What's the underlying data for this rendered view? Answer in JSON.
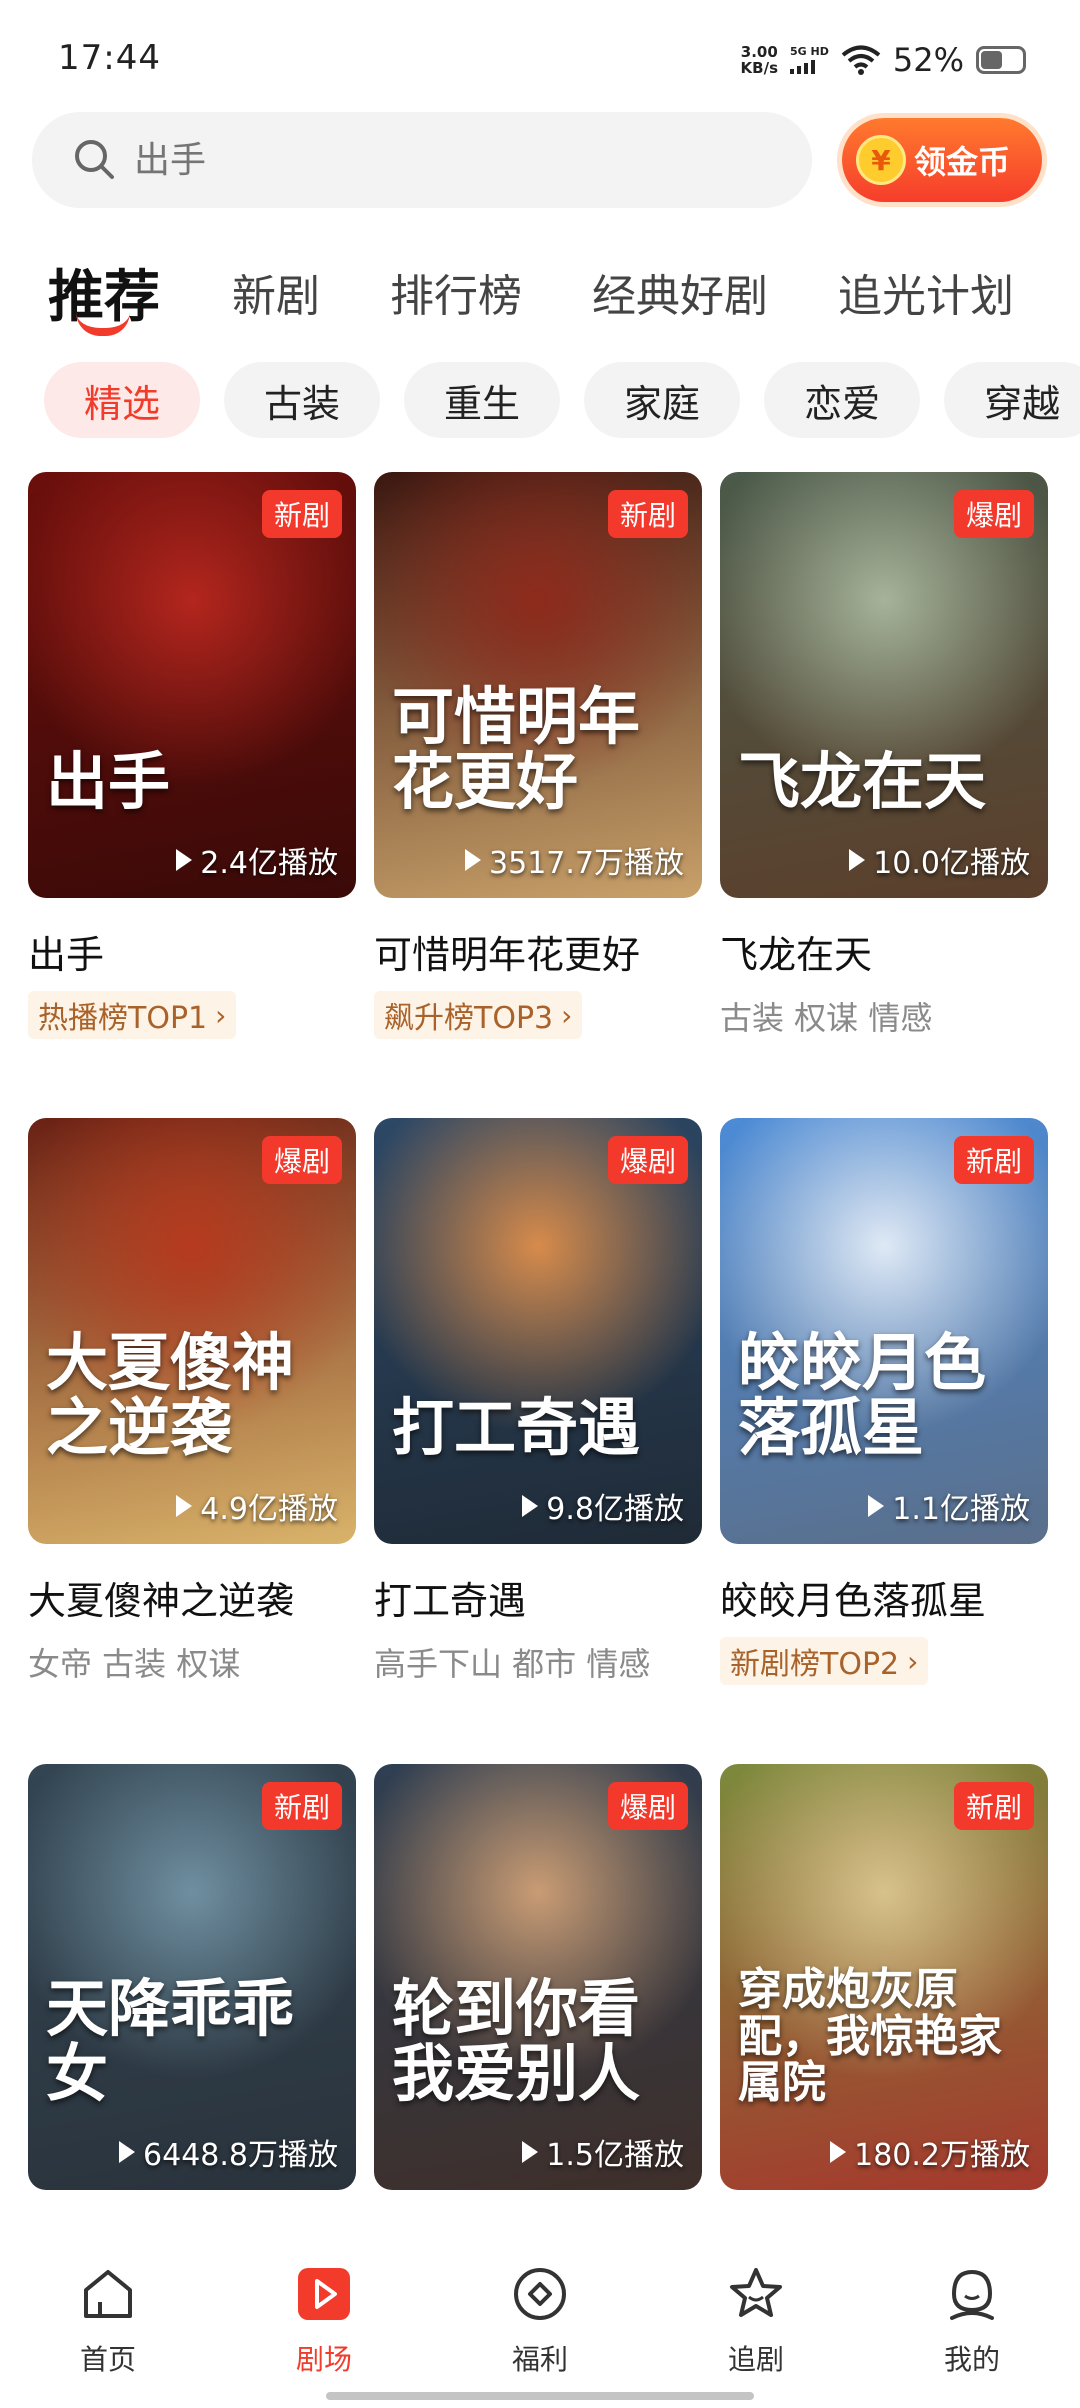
{
  "status_bar": {
    "time": "17:44",
    "net_speed_value": "3.00",
    "net_speed_unit": "KB/s",
    "network": "5G HD",
    "battery": "52%",
    "battery_level": 0.52
  },
  "search": {
    "placeholder": "出手",
    "icon": "search-icon"
  },
  "coin_button": {
    "symbol": "¥",
    "label": "领金币"
  },
  "main_tabs": [
    {
      "label": "推荐",
      "active": true
    },
    {
      "label": "新剧"
    },
    {
      "label": "排行榜"
    },
    {
      "label": "经典好剧"
    },
    {
      "label": "追光计划"
    }
  ],
  "chips": [
    {
      "label": "精选",
      "active": true
    },
    {
      "label": "古装"
    },
    {
      "label": "重生"
    },
    {
      "label": "家庭"
    },
    {
      "label": "恋爱"
    },
    {
      "label": "穿越"
    }
  ],
  "dramas": [
    {
      "title": "出手",
      "badge": "新剧",
      "plays": "2.4亿播放",
      "poster_text": "出手",
      "rank": "热播榜TOP1",
      "tags": ""
    },
    {
      "title": "可惜明年花更好",
      "badge": "新剧",
      "plays": "3517.7万播放",
      "poster_text": "可惜明年花更好",
      "rank": "飙升榜TOP3",
      "tags": ""
    },
    {
      "title": "飞龙在天",
      "badge": "爆剧",
      "plays": "10.0亿播放",
      "poster_text": "飞龙在天",
      "rank": "",
      "tags": "古装 权谋 情感"
    },
    {
      "title": "大夏傻神之逆袭",
      "badge": "爆剧",
      "plays": "4.9亿播放",
      "poster_text": "大夏傻神之逆袭",
      "rank": "",
      "tags": "女帝 古装 权谋"
    },
    {
      "title": "打工奇遇",
      "badge": "爆剧",
      "plays": "9.8亿播放",
      "poster_text": "打工奇遇",
      "rank": "",
      "tags": "高手下山 都市 情感"
    },
    {
      "title": "皎皎月色落孤星",
      "badge": "新剧",
      "plays": "1.1亿播放",
      "poster_text": "皎皎月色落孤星",
      "rank": "新剧榜TOP2",
      "tags": ""
    },
    {
      "title": "",
      "badge": "新剧",
      "plays": "6448.8万播放",
      "poster_text": "天降乖乖女",
      "rank": "",
      "tags": ""
    },
    {
      "title": "",
      "badge": "爆剧",
      "plays": "1.5亿播放",
      "poster_text": "轮到你看我爱别人",
      "rank": "",
      "tags": ""
    },
    {
      "title": "",
      "badge": "新剧",
      "plays": "180.2万播放",
      "poster_text": "穿成炮灰原配，我惊艳家属院",
      "rank": "",
      "tags": ""
    }
  ],
  "poster_palettes": [
    [
      "#6b0f0c",
      "#b3261e",
      "#3a0a08"
    ],
    [
      "#3b1710",
      "#8e2a1c",
      "#c9a16a"
    ],
    [
      "#4b5a4a",
      "#a6b39a",
      "#5b3f2b"
    ],
    [
      "#6a2114",
      "#b63a1e",
      "#d9b36a"
    ],
    [
      "#2c4866",
      "#d78b4b",
      "#1f2a36"
    ],
    [
      "#4c8bd6",
      "#dfe9f5",
      "#5a6f8b"
    ],
    [
      "#334552",
      "#6f8fa0",
      "#2a333c"
    ],
    [
      "#2f3f52",
      "#c99c74",
      "#3e2f2a"
    ],
    [
      "#7c8a3c",
      "#d8c28c",
      "#a5392d"
    ]
  ],
  "bottom_nav": [
    {
      "label": "首页",
      "icon": "home-icon"
    },
    {
      "label": "剧场",
      "icon": "theater-play-icon",
      "active": true
    },
    {
      "label": "福利",
      "icon": "welfare-coin-icon"
    },
    {
      "label": "追剧",
      "icon": "star-follow-icon"
    },
    {
      "label": "我的",
      "icon": "profile-icon"
    }
  ],
  "colors": {
    "accent": "#f23b2a",
    "rank_tag_bg": "#fdf3e6",
    "rank_tag_text": "#a9622a",
    "chip_bg": "#f3f3f3"
  }
}
